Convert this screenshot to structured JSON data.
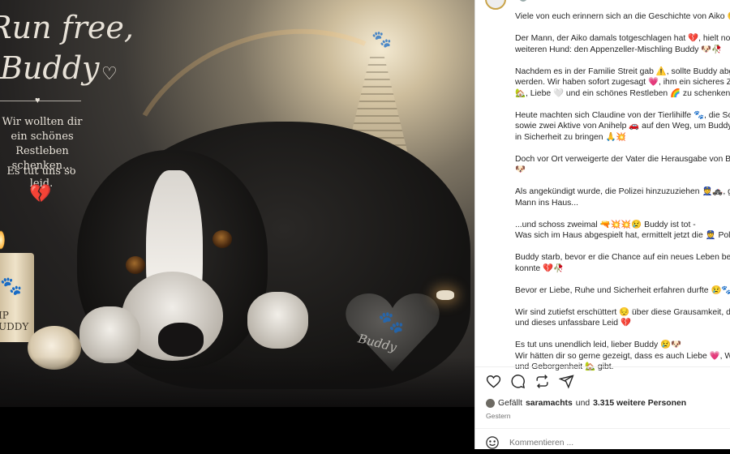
{
  "image": {
    "title_line1": "Run free,",
    "title_line2": "Buddy",
    "message": "Wir wollten dir ein schönes Restleben schenken...",
    "sorry": "Es tut uns so leid.",
    "candle_text": "IP\nUDDY",
    "stone_text": "Buddy",
    "icons": [
      "heart-outline-icon",
      "broken-heart-icon",
      "paw-icon"
    ]
  },
  "caption": {
    "lines": [
      "Viele von euch erinnern sich an die Geschichte von Aiko 😔",
      "Der Mann, der Aiko damals totgeschlagen hat 💔, hielt noch",
      "weiteren Hund: den Appenzeller-Mischling Buddy 🐶🥀",
      "Nachdem es in der Familie Streit gab ⚠️, sollte Buddy abgeg",
      "werden. Wir haben sofort zugesagt 💗, ihm ein sicheres Zuh",
      "🏡, Liebe 🤍 und ein schönes Restleben 🌈 zu schenken.",
      "Heute machten sich Claudine von der Tierlihilfe 🐾, die Schw",
      "sowie zwei Aktive von Anihelp 🚗 auf den Weg, um Buddy e",
      "in Sicherheit zu bringen 🙏💥",
      "Doch vor Ort verweigerte der Vater die Herausgabe von Bud",
      "🐶",
      "Als angekündigt wurde, die Polizei hinzuzuziehen 👮🚓, gin",
      "Mann ins Haus...",
      "...und schoss zweimal 🔫💥💥😢 Buddy ist tot -",
      "Was sich im Haus abgespielt hat, ermittelt jetzt die 👮 Polize",
      "Buddy starb, bevor er die Chance auf ein neues Leben bekon",
      "konnte 💔🥀",
      "Bevor er Liebe, Ruhe und Sicherheit erfahren durfte 😢🐾",
      "Wir sind zutiefst erschüttert 😔 über diese Grausamkeit, dies",
      "und dieses unfassbare Leid 💔",
      "Es tut uns unendlich leid, lieber Buddy 😢🐶",
      "Wir hätten dir so gerne gezeigt, dass es auch Liebe 💗, Wär",
      "und Geborgenheit 🏡 gibt."
    ]
  },
  "likes": {
    "prefix": "Gefällt",
    "user": "saramachts",
    "middle": "und",
    "count": "3.315 weitere Personen"
  },
  "timestamp": "Gestern",
  "comment": {
    "placeholder": "Kommentieren ..."
  },
  "icons": {
    "like": "heart-icon",
    "comment": "comment-icon",
    "repost": "repost-icon",
    "share": "share-icon",
    "emoji": "emoji-icon"
  }
}
